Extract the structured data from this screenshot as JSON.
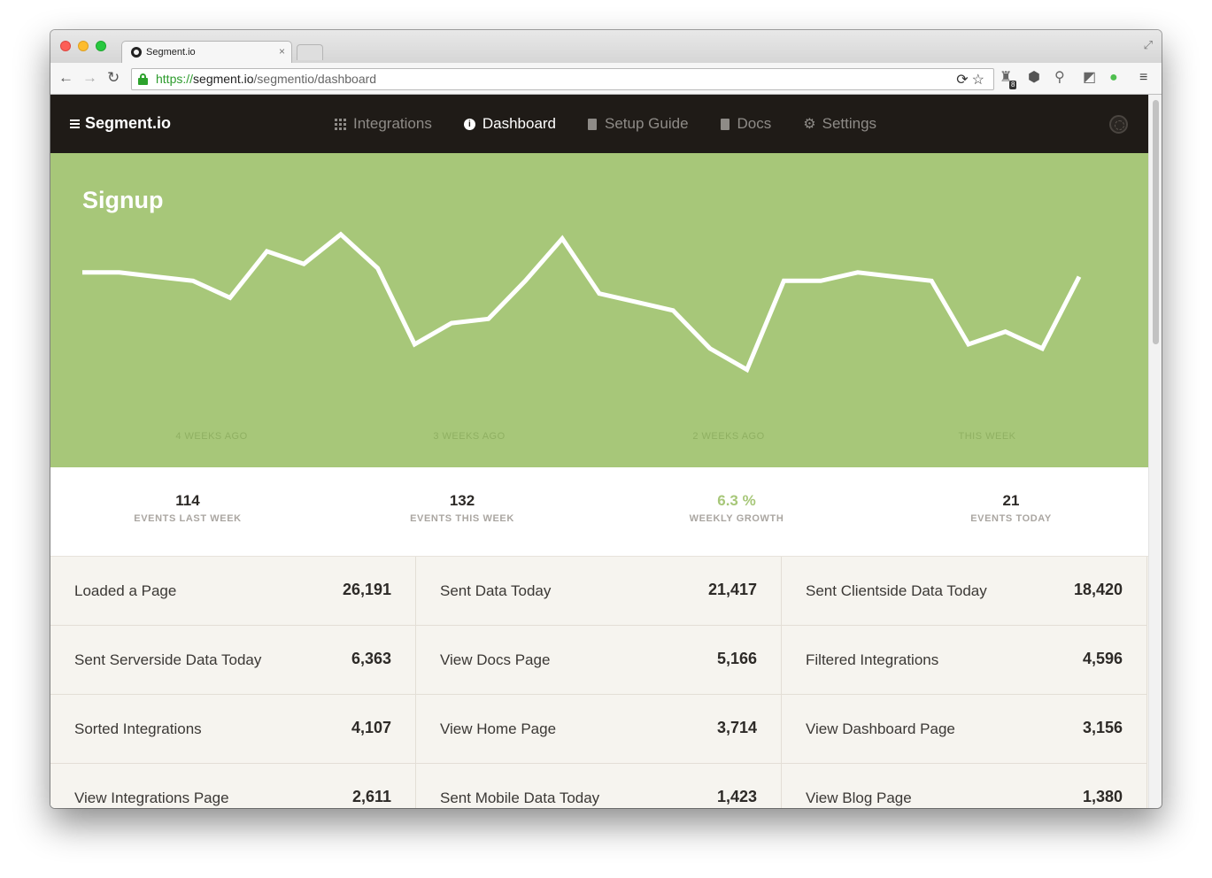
{
  "browser": {
    "tab_title": "Segment.io",
    "tab_close": "×",
    "url_scheme": "https://",
    "url_host": "segment.io",
    "url_path": "/segmentio/dashboard",
    "extension_badge": "8"
  },
  "app": {
    "brand": "Segment.io",
    "nav": [
      {
        "label": "Integrations",
        "icon": "grid-icon",
        "active": false
      },
      {
        "label": "Dashboard",
        "icon": "info-icon",
        "active": true
      },
      {
        "label": "Setup Guide",
        "icon": "document-icon",
        "active": false
      },
      {
        "label": "Docs",
        "icon": "document-icon",
        "active": false
      },
      {
        "label": "Settings",
        "icon": "gear-icon",
        "active": false
      }
    ]
  },
  "chart_data": {
    "type": "line",
    "title": "Signup",
    "x_labels": [
      "4 WEEKS AGO",
      "3 WEEKS AGO",
      "2 WEEKS AGO",
      "THIS WEEK"
    ],
    "series": [
      {
        "values": [
          12,
          12,
          11,
          10,
          6,
          17,
          14,
          21,
          13,
          -5,
          0,
          1,
          10,
          20,
          7,
          5,
          3,
          -6,
          -11,
          10,
          10,
          12,
          11,
          10,
          -5,
          -2,
          -6,
          11
        ]
      }
    ],
    "ylim": [
      -14,
      22
    ],
    "grid": false,
    "colors": {
      "background": "#a7c779",
      "line": "#ffffff"
    }
  },
  "stats": [
    {
      "value": "114",
      "label": "EVENTS LAST WEEK",
      "highlight": false
    },
    {
      "value": "132",
      "label": "EVENTS THIS WEEK",
      "highlight": false
    },
    {
      "value": "6.3 %",
      "label": "WEEKLY GROWTH",
      "highlight": true
    },
    {
      "value": "21",
      "label": "EVENTS TODAY",
      "highlight": false
    }
  ],
  "events": [
    {
      "name": "Loaded a Page",
      "count": "26,191"
    },
    {
      "name": "Sent Data Today",
      "count": "21,417"
    },
    {
      "name": "Sent Clientside Data Today",
      "count": "18,420"
    },
    {
      "name": "Sent Serverside Data Today",
      "count": "6,363"
    },
    {
      "name": "View Docs Page",
      "count": "5,166"
    },
    {
      "name": "Filtered Integrations",
      "count": "4,596"
    },
    {
      "name": "Sorted Integrations",
      "count": "4,107"
    },
    {
      "name": "View Home Page",
      "count": "3,714"
    },
    {
      "name": "View Dashboard Page",
      "count": "3,156"
    },
    {
      "name": "View Integrations Page",
      "count": "2,611"
    },
    {
      "name": "Sent Mobile Data Today",
      "count": "1,423"
    },
    {
      "name": "View Blog Page",
      "count": "1,380"
    }
  ]
}
